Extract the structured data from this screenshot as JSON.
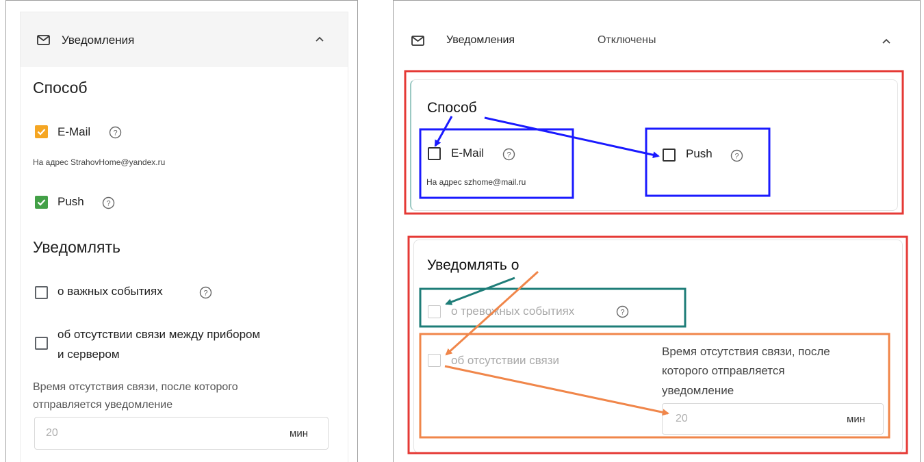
{
  "left": {
    "header_title": "Уведомления",
    "method_heading": "Способ",
    "email_label": "E-Mail",
    "email_address": "На адрес StrahovHome@yandex.ru",
    "push_label": "Push",
    "notify_heading": "Уведомлять",
    "important_events_label": "о важных событиях",
    "no_connection_label_line1": "об отсутствии связи между прибором",
    "no_connection_label_line2": "и сервером",
    "timeout_label_line1": "Время отсутствия связи, после которого",
    "timeout_label_line2": "отправляется уведомление",
    "timeout_value": "20",
    "timeout_unit": "мин",
    "email_checked": true,
    "push_checked": true,
    "important_checked": false,
    "no_connection_checked": false
  },
  "right": {
    "header_title": "Уведомления",
    "status": "Отключены",
    "method_heading": "Способ",
    "email_label": "E-Mail",
    "email_address": "На адрес szhome@mail.ru",
    "push_label": "Push",
    "notify_heading": "Уведомлять о",
    "alarm_events_label": "о тревожных событиях",
    "no_connection_label": "об отсутствии связи",
    "timeout_label_line1": "Время отсутствия связи, после",
    "timeout_label_line2": "которого отправляется",
    "timeout_label_line3": "уведомление",
    "timeout_value": "20",
    "timeout_unit": "мин",
    "email_checked": false,
    "push_checked": false,
    "alarm_checked": false,
    "no_connection_checked": false
  },
  "colors": {
    "checkbox_orange": "#f5a623",
    "checkbox_green": "#43a047",
    "annotation_red": "#e53935",
    "annotation_blue": "#1a1aff",
    "annotation_teal": "#1e7d78",
    "annotation_orange": "#f0864a"
  },
  "icons": [
    "mail-icon",
    "chevron-up-icon",
    "help-circle-icon",
    "checkmark-icon"
  ]
}
